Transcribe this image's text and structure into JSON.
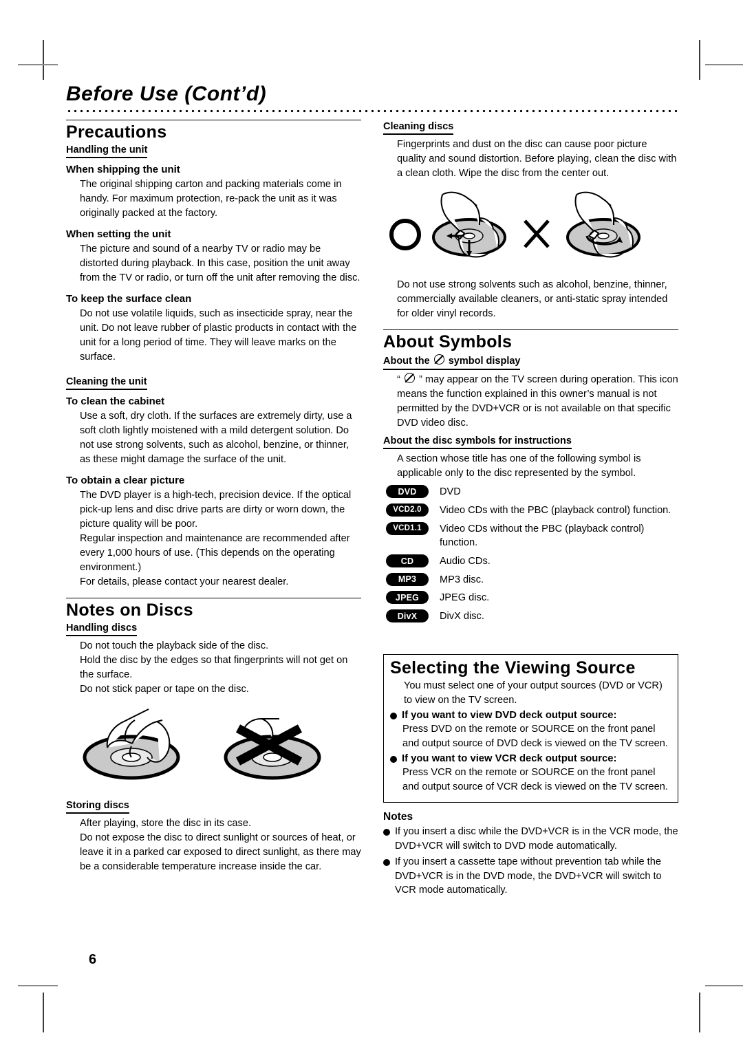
{
  "page": {
    "chapter_title": "Before Use (Cont’d)",
    "page_number": "6"
  },
  "left_column": {
    "precautions": {
      "heading": "Precautions",
      "handling_the_unit": {
        "subheading": "Handling the unit",
        "topics": [
          {
            "title": "When shipping the unit",
            "body": "The original shipping carton and packing materials come in handy. For maximum protection, re-pack the unit as it was originally packed at the factory."
          },
          {
            "title": "When setting the unit",
            "body": "The picture and sound of a nearby TV or radio may be distorted during playback. In this case, position the unit away from the TV or radio, or turn off the unit after removing the disc."
          },
          {
            "title": "To keep the surface clean",
            "body": "Do not use volatile liquids, such as insecticide spray, near the unit. Do not leave rubber of plastic products in contact with the unit for a long period of time. They will leave marks on the surface."
          }
        ]
      },
      "cleaning_the_unit": {
        "subheading": "Cleaning the unit",
        "topics": [
          {
            "title": "To clean the cabinet",
            "body": "Use a soft, dry cloth. If the surfaces are extremely dirty, use a soft cloth lightly moistened with a mild detergent solution. Do not use strong solvents, such as alcohol, benzine, or thinner, as these might damage the surface of the unit."
          },
          {
            "title": "To obtain a clear picture",
            "body_1": "The DVD player is a high-tech, precision device. If the optical pick-up lens and disc drive parts are dirty or worn down, the picture quality will be poor.",
            "body_2": "Regular inspection and maintenance are recommended after every 1,000 hours of use. (This depends on the operating environment.)",
            "body_3": "For details, please contact your nearest dealer."
          }
        ]
      }
    },
    "notes_on_discs": {
      "heading": "Notes on Discs",
      "handling_discs": {
        "subheading": "Handling discs",
        "lines": [
          "Do not touch the playback side of the disc.",
          "Hold the disc by the edges so that fingerprints will not get on the surface.",
          "Do not stick paper or tape on the disc."
        ]
      },
      "storing_discs": {
        "subheading": "Storing discs",
        "lines": [
          "After playing, store the disc in its case.",
          "Do not expose the disc to direct sunlight or sources of heat, or leave it in a parked car exposed to direct sunlight, as there may be a considerable temperature increase inside the car."
        ]
      }
    }
  },
  "right_column": {
    "cleaning_discs": {
      "subheading": "Cleaning discs",
      "body": "Fingerprints and dust on the disc can cause poor picture quality and sound distortion. Before playing, clean the disc with a clean cloth. Wipe the disc from the center out.",
      "caption_after": "Do not use strong solvents such as alcohol, benzine, thinner, commercially available cleaners, or anti-static spray intended for older vinyl records."
    },
    "about_symbols": {
      "heading": "About Symbols",
      "symbol_display": {
        "subheading_before": "About the",
        "subheading_after": "symbol display",
        "body_before": "“",
        "body_after": "” may appear on the TV screen during operation. This icon means the function explained in this owner’s manual is not permitted by the DVD+VCR or is not available on that specific DVD video disc."
      },
      "disc_symbols": {
        "subheading": "About the disc symbols for instructions",
        "intro": "A section whose title has one of the following symbol is applicable only to the disc represented by the symbol.",
        "items": [
          {
            "badge": "DVD",
            "desc": "DVD"
          },
          {
            "badge": "VCD2.0",
            "desc": "Video CDs with the PBC (playback control) function."
          },
          {
            "badge": "VCD1.1",
            "desc": "Video CDs without the PBC (playback control) function."
          },
          {
            "badge": "CD",
            "desc": "Audio CDs."
          },
          {
            "badge": "MP3",
            "desc": "MP3 disc."
          },
          {
            "badge": "JPEG",
            "desc": "JPEG disc."
          },
          {
            "badge": "DivX",
            "desc": "DivX disc."
          }
        ]
      }
    },
    "viewing_source": {
      "heading": "Selecting the Viewing Source",
      "intro": "You must select one of your output sources (DVD or VCR) to view on the TV screen.",
      "bullets": [
        {
          "label": "If you want to view DVD deck output source",
          "body": "Press DVD on the remote or SOURCE on the front panel and output source of DVD deck is viewed on the TV screen."
        },
        {
          "label": "If you want to view VCR deck output source",
          "body": "Press VCR on the remote or SOURCE on the front panel and output source of VCR deck is viewed on the TV screen."
        }
      ]
    },
    "notes": {
      "heading": "Notes",
      "items": [
        "If you insert a disc while the DVD+VCR is in the VCR mode, the DVD+VCR will switch to DVD mode automatically.",
        "If you insert a cassette tape without prevention tab while the DVD+VCR is in the DVD mode, the DVD+VCR will switch to VCR mode automatically."
      ]
    }
  },
  "icons": {
    "hand_holding_disc": "hand-holding-disc-icon",
    "disc_crossed_out": "disc-crossed-out-icon",
    "wipe_center_out_ok": "wipe-disc-center-out-ok-icon",
    "wipe_circular_bad": "wipe-disc-circular-bad-icon",
    "circle_ok": "circle-ok-icon",
    "cross_bad": "cross-bad-icon",
    "prohibition": "prohibition-symbol-icon"
  }
}
